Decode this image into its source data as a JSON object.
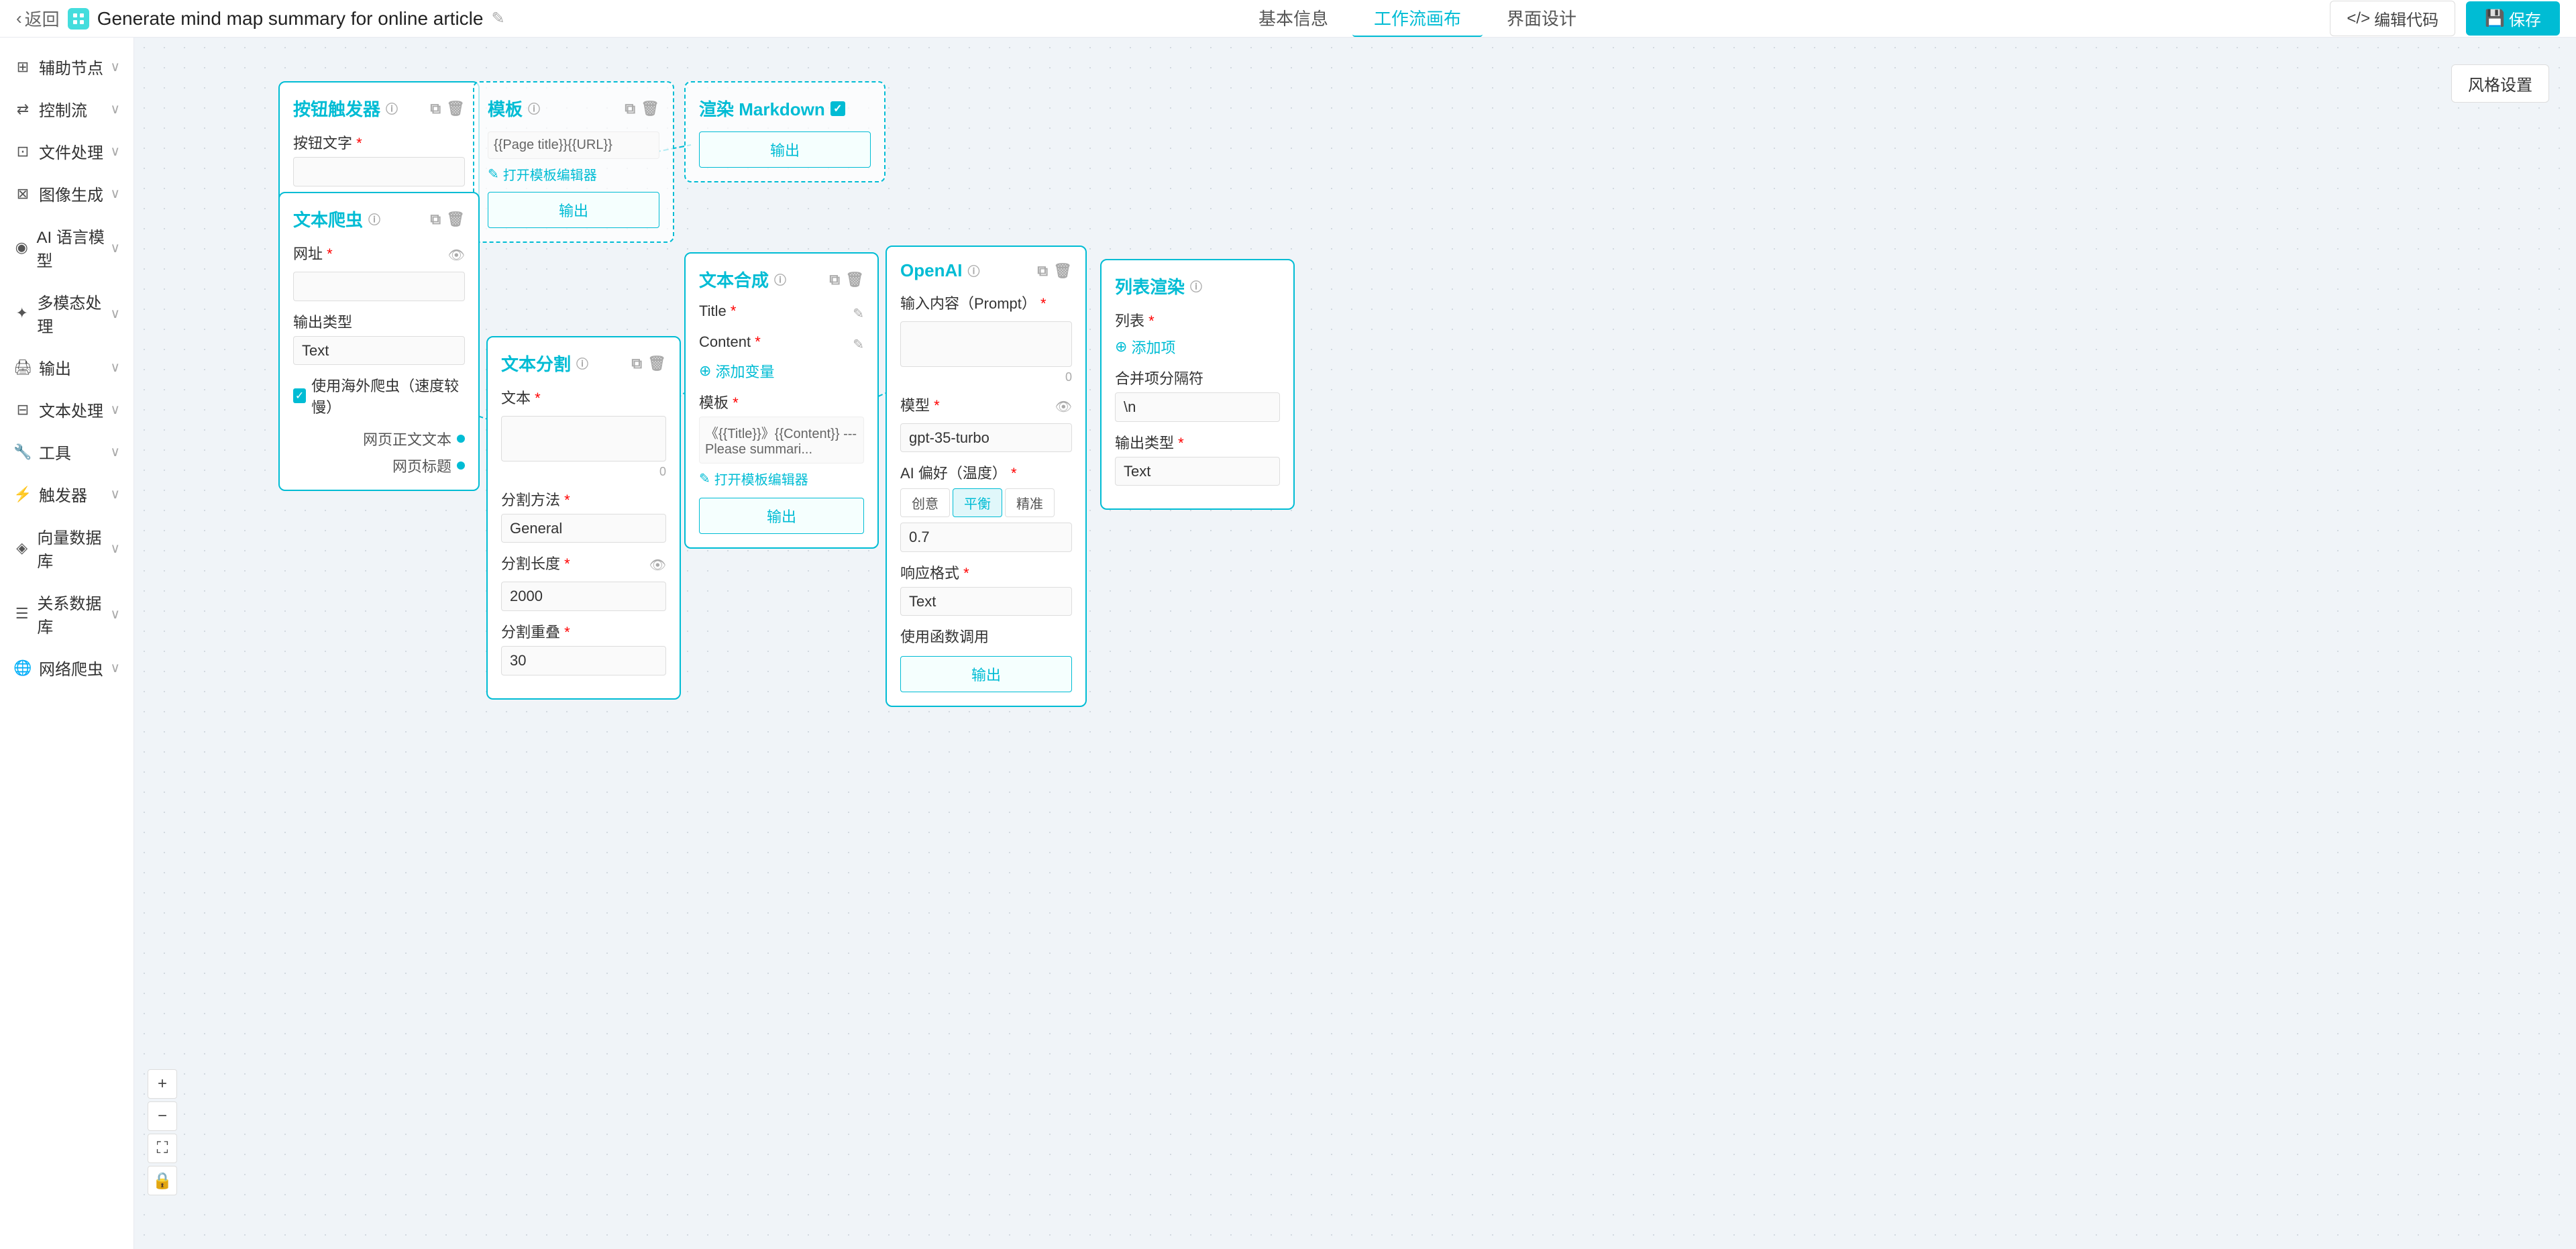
{
  "header": {
    "back_label": "返回",
    "title": "Generate mind map summary for online article",
    "tabs": [
      {
        "id": "basic",
        "label": "基本信息"
      },
      {
        "id": "workflow",
        "label": "工作流画布",
        "active": true
      },
      {
        "id": "ui",
        "label": "界面设计"
      }
    ],
    "code_btn": "编辑代码",
    "save_btn": "保存"
  },
  "sidebar": {
    "items": [
      {
        "id": "aux-node",
        "label": "辅助节点",
        "icon": "⊞"
      },
      {
        "id": "control-flow",
        "label": "控制流",
        "icon": "⇄"
      },
      {
        "id": "file-process",
        "label": "文件处理",
        "icon": "⊡"
      },
      {
        "id": "image-gen",
        "label": "图像生成",
        "icon": "⊠"
      },
      {
        "id": "ai-model",
        "label": "AI 语言模型",
        "icon": "◉"
      },
      {
        "id": "multimodal",
        "label": "多模态处理",
        "icon": "✦"
      },
      {
        "id": "output",
        "label": "输出",
        "icon": "🖨"
      },
      {
        "id": "text-process",
        "label": "文本处理",
        "icon": "⊟"
      },
      {
        "id": "tools",
        "label": "工具",
        "icon": "🔧"
      },
      {
        "id": "trigger",
        "label": "触发器",
        "icon": "⚡"
      },
      {
        "id": "vector-db",
        "label": "向量数据库",
        "icon": "◈"
      },
      {
        "id": "relational-db",
        "label": "关系数据库",
        "icon": "☰"
      },
      {
        "id": "web-crawler",
        "label": "网络爬虫",
        "icon": "🌐"
      }
    ]
  },
  "nodes": {
    "button_trigger": {
      "title": "按钮触发器",
      "field_label": "按钮文字",
      "required": true
    },
    "template_node": {
      "title": "模板",
      "template_text": "{{Page title}}{{URL}}",
      "edit_label": "打开模板编辑器",
      "output_label": "输出"
    },
    "markdown_node": {
      "title": "渲染 Markdown",
      "checked": true,
      "output_label": "输出"
    },
    "text_crawler": {
      "title": "文本爬虫",
      "url_label": "网址",
      "required_url": true,
      "output_type_label": "输出类型",
      "output_type_value": "Text",
      "use_overseas_label": "使用海外爬虫（速度较慢）",
      "checked": true,
      "output1": "网页正文文本",
      "output2": "网页标题"
    },
    "text_split": {
      "title": "文本分割",
      "text_label": "文本",
      "required": true,
      "counter": "0",
      "split_method_label": "分割方法",
      "split_method_value": "General",
      "split_length_label": "分割长度",
      "split_length_value": "2000",
      "split_overlap_label": "分割重叠",
      "split_overlap_value": "30"
    },
    "text_synthesis": {
      "title": "文本合成",
      "title_field": "Title",
      "content_field": "Content",
      "add_variable": "添加变量",
      "template_label": "模板",
      "template_text": "《{{Title}}》{{Content}} --- Please summari...",
      "edit_label": "打开模板编辑器",
      "output_label": "输出"
    },
    "openai": {
      "title": "OpenAI",
      "prompt_label": "输入内容（Prompt）",
      "required": true,
      "counter": "0",
      "model_label": "模型",
      "model_value": "gpt-35-turbo",
      "ai_temp_label": "AI 偏好（温度）",
      "required_temp": true,
      "tab_creative": "创意",
      "tab_balanced": "平衡",
      "tab_precise": "精准",
      "temp_value": "0.7",
      "response_format_label": "响应格式",
      "response_format_value": "Text",
      "use_function_label": "使用函数调用",
      "output_label": "输出"
    },
    "list_render": {
      "title": "列表渲染",
      "list_label": "列表",
      "required": true,
      "add_item": "添加项",
      "separator_label": "合并项分隔符",
      "separator_value": "\\n",
      "output_type_label": "输出类型",
      "output_type_value": "Text"
    }
  },
  "zoom_controls": {
    "plus": "+",
    "minus": "−",
    "fit": "⛶",
    "lock": "🔒"
  },
  "style_settings": "风格设置",
  "colors": {
    "accent": "#00bcd4",
    "border": "#00bcd4",
    "bg": "#f0f4f8"
  }
}
